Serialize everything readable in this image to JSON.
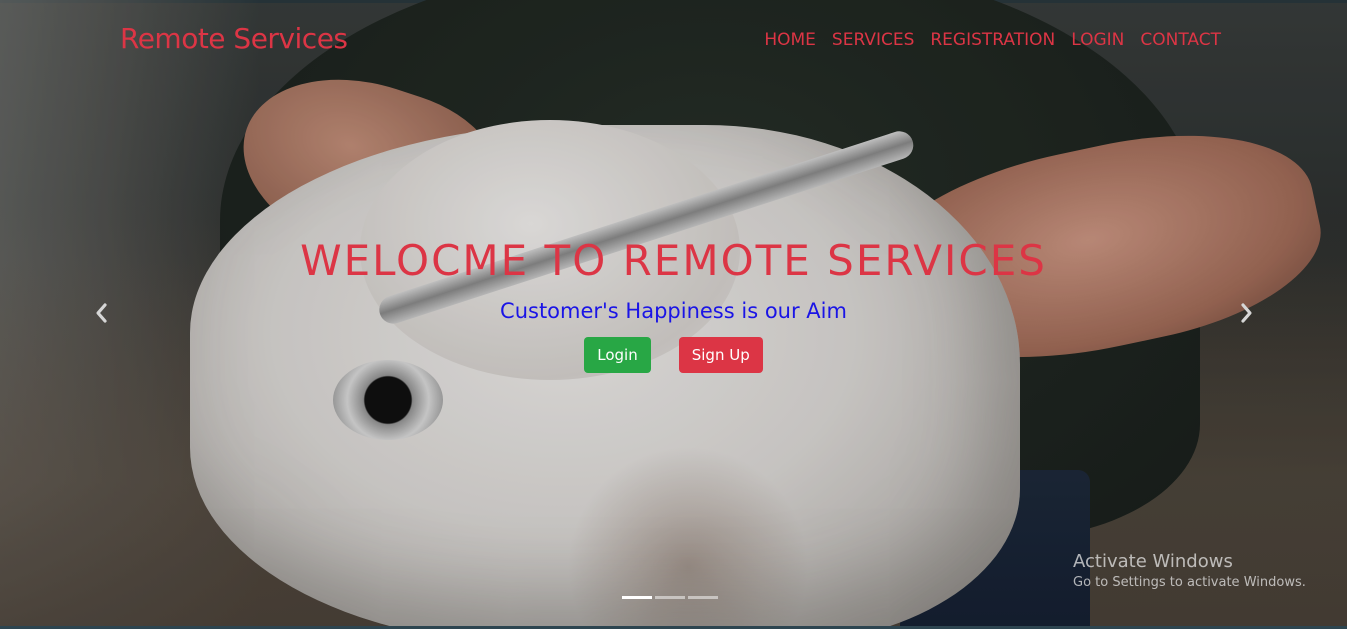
{
  "navbar": {
    "brand": "Remote Services",
    "links": [
      "HOME",
      "SERVICES",
      "REGISTRATION",
      "LOGIN",
      "CONTACT"
    ]
  },
  "carousel": {
    "headline": "WELOCME TO REMOTE SERVICES",
    "tagline": "Customer's Happiness is our Aim",
    "login_button": "Login",
    "signup_button": "Sign Up",
    "prev_icon": "chevron-left-icon",
    "next_icon": "chevron-right-icon",
    "slide_count": 3,
    "active_slide": 1
  },
  "watermark": {
    "title": "Activate Windows",
    "subtitle": "Go to Settings to activate Windows."
  },
  "colors": {
    "brand": "#dc3545",
    "tagline": "#1a14e6",
    "login_button": "#28a745",
    "signup_button": "#dc3545"
  }
}
